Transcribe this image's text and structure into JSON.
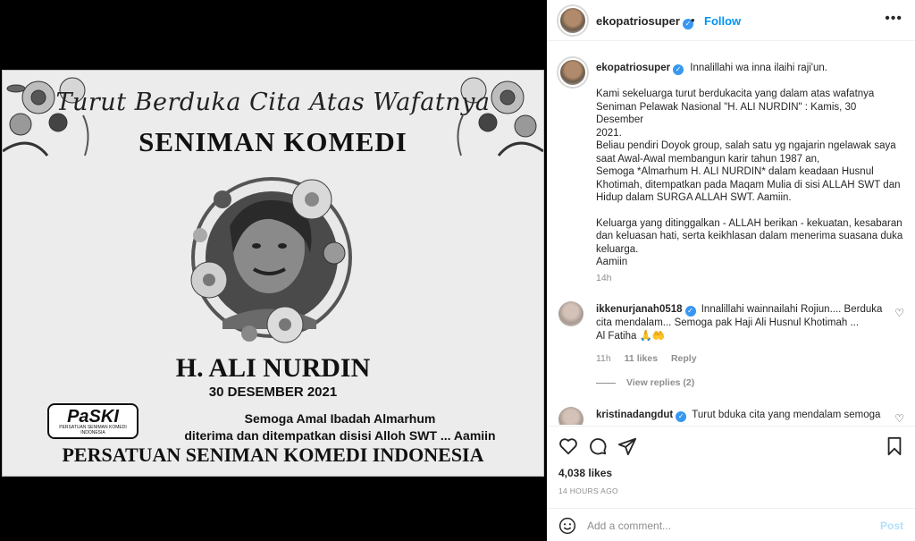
{
  "post": {
    "username": "ekopatriosuper",
    "follow_label": "Follow",
    "separator": "•",
    "more_label": "•••"
  },
  "memorial": {
    "script_line": "Turut Berduka Cita Atas Wafatnya",
    "heading": "SENIMAN KOMEDI",
    "name": "H. ALI NURDIN",
    "date": "30 DESEMBER 2021",
    "prayer_line1": "Semoga Amal Ibadah Almarhum",
    "prayer_line2": "diterima dan  ditempatkan disisi Alloh SWT ... Aamiin",
    "org": "PERSATUAN SENIMAN KOMEDI INDONESIA",
    "logo_text": "PaSKI",
    "logo_sub": "PERSATUAN SENIMAN KOMEDI INDONESIA"
  },
  "caption": {
    "username": "ekopatriosuper",
    "first_line": "Innalillahi wa inna ilaihi raji'un.",
    "p2": [
      "Kami sekeluarga turut berdukacita yang dalam atas wafatnya",
      "Seniman Pelawak Nasional \"H. ALI NURDIN\" : Kamis, 30 Desember",
      "2021.",
      "Beliau pendiri Doyok group, salah satu yg ngajarin ngelawak saya",
      "saat Awal-Awal membangun karir tahun 1987 an,",
      "Semoga *Almarhum H. ALI NURDIN* dalam keadaan Husnul",
      "Khotimah, ditempatkan pada Maqam Mulia di sisi ALLAH SWT dan",
      "Hidup dalam SURGA ALLAH SWT. Aamiin."
    ],
    "p3": [
      "Keluarga yang ditinggalkan - ALLAH berikan - kekuatan, kesabaran",
      "dan keluasan hati, serta keikhlasan dalam menerima suasana duka",
      "keluarga.",
      "Aamiin"
    ],
    "time": "14h"
  },
  "comments": [
    {
      "username": "ikkenurjanah0518",
      "lines": [
        "Innalillahi wainnailahi Rojiun.... Berduka",
        "cita mendalam... Semoga pak Haji Ali Husnul Khotimah ...",
        "Al Fatiha 🙏🤲"
      ],
      "time": "11h",
      "likes": "11 likes",
      "reply": "Reply",
      "view_replies": "View replies (2)"
    },
    {
      "username": "kristinadangdut",
      "lines": [
        "Turut bduka cita yang mendalam semoga"
      ]
    }
  ],
  "actions": {
    "likes": "4,038 likes",
    "time_ago": "14 HOURS AGO"
  },
  "add_comment": {
    "placeholder": "Add a comment...",
    "post_label": "Post"
  },
  "icons": [
    "heart-icon",
    "comment-icon",
    "share-icon",
    "bookmark-icon",
    "emoji-icon",
    "verified-icon",
    "more-icon"
  ],
  "colors": {
    "link": "#0095f6",
    "verified": "#3897f0",
    "post_disabled": "#b2dffc",
    "muted": "#8e8e8e"
  }
}
